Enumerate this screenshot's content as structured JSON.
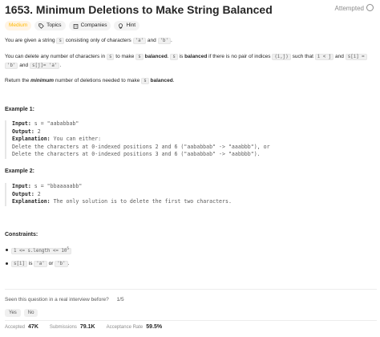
{
  "header": {
    "title": "1653. Minimum Deletions to Make String Balanced",
    "status": "Attempted"
  },
  "tags": {
    "difficulty": "Medium",
    "topics": "Topics",
    "companies": "Companies",
    "hint": "Hint"
  },
  "description": {
    "p1_a": "You are given a string",
    "p1_s": "s",
    "p1_b": "consisting only of characters",
    "p1_ca": "'a'",
    "p1_and": "and",
    "p1_cb": "'b'",
    "p1_end": ".",
    "p2_a": "You can delete any number of characters in",
    "p2_s": "s",
    "p2_b": "to make",
    "p2_s2": "s",
    "p2_bal": "balanced",
    "p2_c": ".",
    "p2_s3": "s",
    "p2_is": "is",
    "p2_bal2": "balanced",
    "p2_d": "if there is no pair of indices",
    "p2_ij": "(i,j)",
    "p2_e": "such that",
    "p2_iltj": "i < j",
    "p2_and": "and",
    "p2_si": "s[i] =",
    "p2_b_code": "'b'",
    "p2_and2": "and",
    "p2_sj": "s[j]= 'a'",
    "p2_end": ".",
    "p3_a": "Return the",
    "p3_min": "minimum",
    "p3_b": "number of deletions needed to make",
    "p3_s": "s",
    "p3_bal": "balanced",
    "p3_end": "."
  },
  "examples": [
    {
      "heading": "Example 1:",
      "input_label": "Input:",
      "input_value": " s = \"aababbab\"",
      "output_label": "Output:",
      "output_value": " 2",
      "explanation_label": "Explanation:",
      "explanation_value": " You can either:",
      "line4": "Delete the characters at 0-indexed positions 2 and 6 (\"aababbab\" -> \"aaabbb\"), or",
      "line5": "Delete the characters at 0-indexed positions 3 and 6 (\"aababbab\" -> \"aabbbb\")."
    },
    {
      "heading": "Example 2:",
      "input_label": "Input:",
      "input_value": " s = \"bbaaaaabb\"",
      "output_label": "Output:",
      "output_value": " 2",
      "explanation_label": "Explanation:",
      "explanation_value": " The only solution is to delete the first two characters."
    }
  ],
  "constraints": {
    "heading": "Constraints:",
    "c1": "1 <= s.length <= 10",
    "c1_sup": "5",
    "c2_code": "s[i]",
    "c2_is": "is",
    "c2_a": "'a'",
    "c2_or": "or",
    "c2_b": "'b'",
    "c2_end": "."
  },
  "survey": {
    "question": "Seen this question in a real interview before?",
    "progress": "1/5",
    "yes": "Yes",
    "no": "No"
  },
  "stats": {
    "accepted_label": "Accepted",
    "accepted_value": "47K",
    "submissions_label": "Submissions",
    "submissions_value": "79.1K",
    "rate_label": "Acceptance Rate",
    "rate_value": "59.5%"
  },
  "colors": {
    "medium": "#ffb800",
    "medium_bg": "#fff4e5",
    "text": "#262626",
    "muted": "#8c8c8c"
  }
}
